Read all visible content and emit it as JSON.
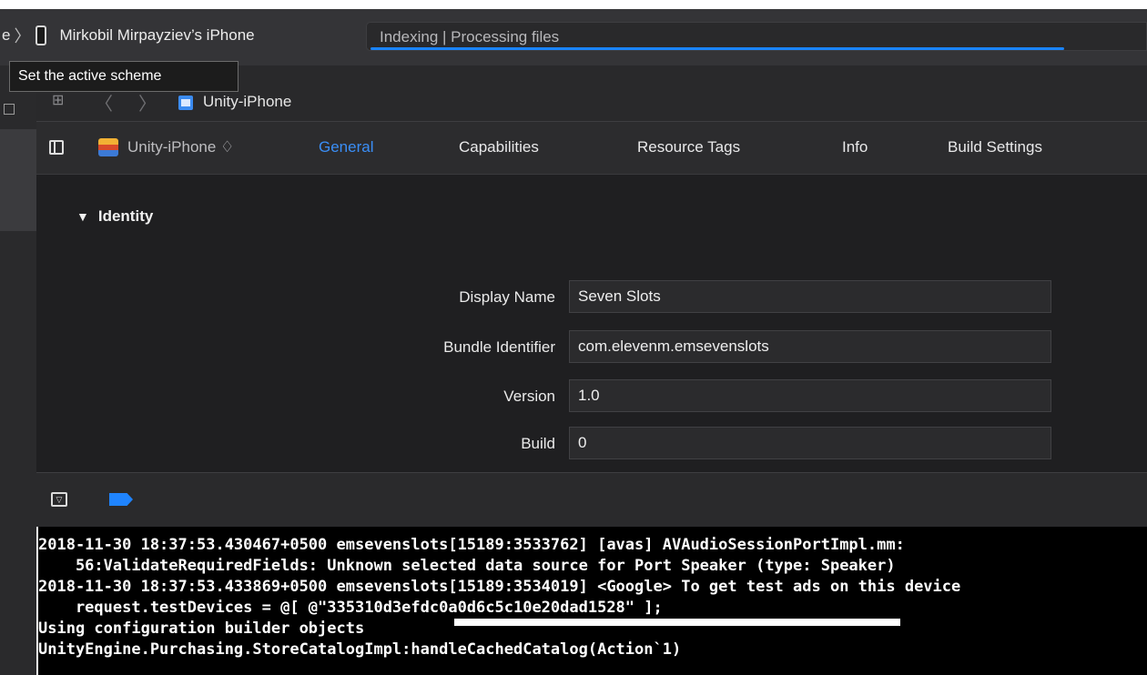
{
  "toolbar": {
    "scheme_tail": "e",
    "device_name": "Mirkobil Mirpayziev’s iPhone",
    "activity_status": "Indexing | Processing files",
    "activity_progress": 0.89
  },
  "tooltip": {
    "text": "Set the active scheme"
  },
  "jumpbar": {
    "project_name": "Unity-iPhone"
  },
  "tabbar": {
    "target_name": "Unity-iPhone ♢",
    "tabs": [
      {
        "label": "General",
        "active": true
      },
      {
        "label": "Capabilities",
        "active": false
      },
      {
        "label": "Resource Tags",
        "active": false
      },
      {
        "label": "Info",
        "active": false
      },
      {
        "label": "Build Settings",
        "active": false
      }
    ]
  },
  "identity": {
    "section_title": "Identity",
    "fields": [
      {
        "label": "Display Name",
        "value": "Seven Slots"
      },
      {
        "label": "Bundle Identifier",
        "value": "com.elevenm.emsevenslots"
      },
      {
        "label": "Version",
        "value": "1.0"
      },
      {
        "label": "Build",
        "value": "0"
      }
    ]
  },
  "console": {
    "lines": [
      "2018-11-30 18:37:53.430467+0500 emsevenslots[15189:3533762] [avas] AVAudioSessionPortImpl.mm:",
      "    56:ValidateRequiredFields: Unknown selected data source for Port Speaker (type: Speaker)",
      "2018-11-30 18:37:53.433869+0500 emsevenslots[15189:3534019] <Google> To get test ads on this device",
      "    request.testDevices = @[ @\"335310d3efdc0a0d6c5c10e20dad1528\" ];",
      "Using configuration builder objects",
      "UnityEngine.Purchasing.StoreCatalogImpl:handleCachedCatalog(Action`1)"
    ]
  },
  "colors": {
    "accent": "#3a8ef6",
    "progress": "#1a84ff",
    "background": "#1f1f21"
  }
}
